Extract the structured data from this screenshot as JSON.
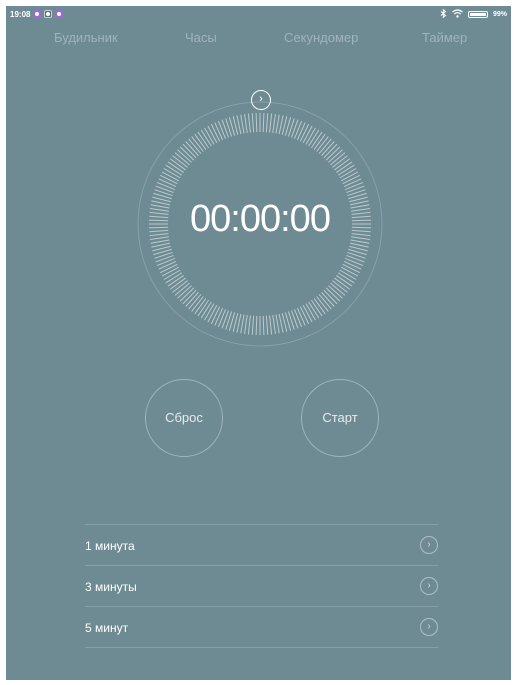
{
  "status_bar": {
    "time": "19:08",
    "battery": "99%",
    "battery_level": 0.99,
    "icons": [
      "notification-icon",
      "notification-icon",
      "notification-icon",
      "bluetooth-icon",
      "wifi-icon",
      "battery-icon"
    ]
  },
  "tabs": [
    {
      "label": "Будильник",
      "active": false
    },
    {
      "label": "Часы",
      "active": false
    },
    {
      "label": "Секундомер",
      "active": false
    },
    {
      "label": "Таймер",
      "active": true
    }
  ],
  "timer": {
    "display": "00:00:00",
    "handle_icon": "chevron-right-icon"
  },
  "buttons": {
    "reset": "Сброс",
    "start": "Старт"
  },
  "presets": [
    {
      "label": "1 минута",
      "icon": "chevron-right-icon"
    },
    {
      "label": "3 минуты",
      "icon": "chevron-right-icon"
    },
    {
      "label": "5 минут",
      "icon": "chevron-right-icon"
    }
  ],
  "colors": {
    "background": "#6e8b94",
    "text_primary": "#ffffff",
    "text_inactive": "#9fb4bb"
  }
}
